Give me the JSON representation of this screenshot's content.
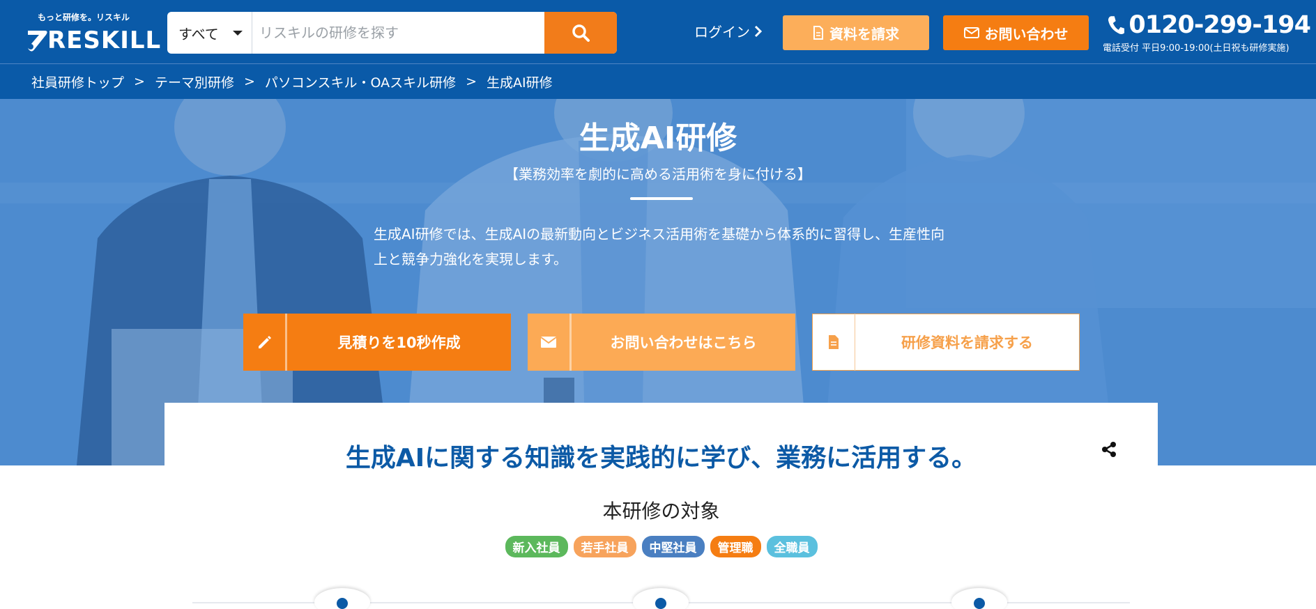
{
  "header": {
    "logo_tagline": "もっと研修を。リスキル",
    "logo_text": "RESKILL",
    "search": {
      "category": "すべて",
      "placeholder": "リスキルの研修を探す",
      "value": ""
    },
    "login_label": "ログイン",
    "doc_button_label": "資料を請求",
    "contact_button_label": "お問い合わせ",
    "phone_number": "0120-299-194",
    "phone_hours": "電話受付 平日9:00-19:00(土日祝も研修実施)"
  },
  "breadcrumb": {
    "items": [
      "社員研修トップ",
      "テーマ別研修",
      "パソコンスキル・OAスキル研修",
      "生成AI研修"
    ],
    "separator": ">"
  },
  "hero": {
    "title": "生成AI研修",
    "subtitle": "【業務効率を劇的に高める活用術を身に付ける】",
    "description": "生成AI研修では、生成AIの最新動向とビジネス活用術を基礎から体系的に習得し、生産性向上と競争力強化を実現します。",
    "cta": [
      {
        "label": "見積りを10秒作成",
        "icon": "pencil-icon"
      },
      {
        "label": "お問い合わせはこちら",
        "icon": "envelope-icon"
      },
      {
        "label": "研修資料を請求する",
        "icon": "document-icon"
      }
    ]
  },
  "content": {
    "heading": "生成AIに関する知識を実践的に学び、業務に活用する。",
    "target_title": "本研修の対象",
    "tags": [
      {
        "label": "新入社員",
        "color": "#5cb85c"
      },
      {
        "label": "若手社員",
        "color": "#f7a35c"
      },
      {
        "label": "中堅社員",
        "color": "#4a7fc1"
      },
      {
        "label": "管理職",
        "color": "#f57d12"
      },
      {
        "label": "全職員",
        "color": "#5bc0de"
      }
    ]
  },
  "colors": {
    "brand_blue": "#0a5aa8",
    "accent_orange": "#f57d12",
    "light_orange": "#fcae5a",
    "heading_blue": "#0c5aa6"
  }
}
